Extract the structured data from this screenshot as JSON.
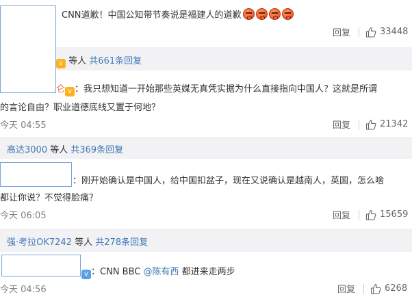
{
  "reply1": {
    "text": "CNN道歉！中国公知带节奏说是福建人的道歉",
    "emoji_icons": [
      "angry-face-icon",
      "angry-face-icon",
      "angry-face-icon",
      "angry-face-icon"
    ],
    "reply_label": "回复",
    "likes": "33448"
  },
  "thread1": {
    "users_suffix": "等人",
    "count_text": "共661条回复"
  },
  "reply2": {
    "name_tail": "仑",
    "line1": "：我只想知道一开始那些英媒无真凭实据为什么直接指向中国人？这就是所谓",
    "line2": "的言论自由？职业道德底线又置于何地？",
    "time": "今天 04:55",
    "reply_label": "回复",
    "likes": "21342"
  },
  "thread2": {
    "user": "高达3000",
    "users_suffix": "等人",
    "count_text": "共369条回复"
  },
  "reply3": {
    "line1": "：刚开始确认是中国人，给中国扣盆子，现在又说确认是越南人，英国，怎么啥",
    "line2": "都让你说？不觉得脸痛？",
    "time": "今天 06:05",
    "reply_label": "回复",
    "likes": "15659"
  },
  "thread3": {
    "user": "强·考拉OK7242",
    "users_suffix": "等人",
    "count_text": "共278条回复"
  },
  "reply4": {
    "text_before": "：CNN BBC ",
    "mention": "@陈有西",
    "text_after": " 都进来走两步",
    "time": "今天 04:56",
    "reply_label": "回复",
    "likes": "6268"
  },
  "colors": {
    "link": "#eb7350",
    "sublink": "#3f78b5",
    "thread_bg": "#f2f2f5"
  }
}
